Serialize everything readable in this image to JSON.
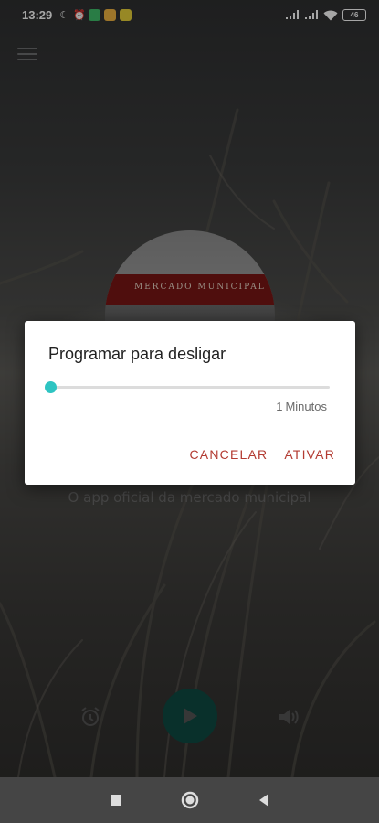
{
  "status_bar": {
    "time": "13:29",
    "battery": "46",
    "icons": [
      "moon-icon",
      "alarm-icon",
      "app-badge-green",
      "app-badge-orange",
      "app-badge-yellow",
      "signal-icon",
      "signal-icon",
      "wifi-icon",
      "battery-icon"
    ]
  },
  "toolbar": {
    "menu_icon": "hamburger-menu-icon"
  },
  "station": {
    "logo_sign_text": "MERCADO MUNICIPAL",
    "subtitle": "O app oficial da mercado municipal"
  },
  "player": {
    "alarm_icon": "alarm-clock-icon",
    "play_icon": "play-icon",
    "volume_icon": "volume-icon",
    "play_color": "#0f4a43"
  },
  "dialog": {
    "title": "Programar para desligar",
    "slider_value": 1,
    "slider_fraction": 0.0,
    "minutes_value": "1",
    "minutes_unit": "Minutos",
    "cancel_label": "CANCELAR",
    "activate_label": "ATIVAR",
    "accent_color": "#2ec4c2",
    "button_color": "#b33b32"
  },
  "nav_bar": {
    "recents_icon": "square-icon",
    "home_icon": "circle-icon",
    "back_icon": "triangle-back-icon"
  }
}
